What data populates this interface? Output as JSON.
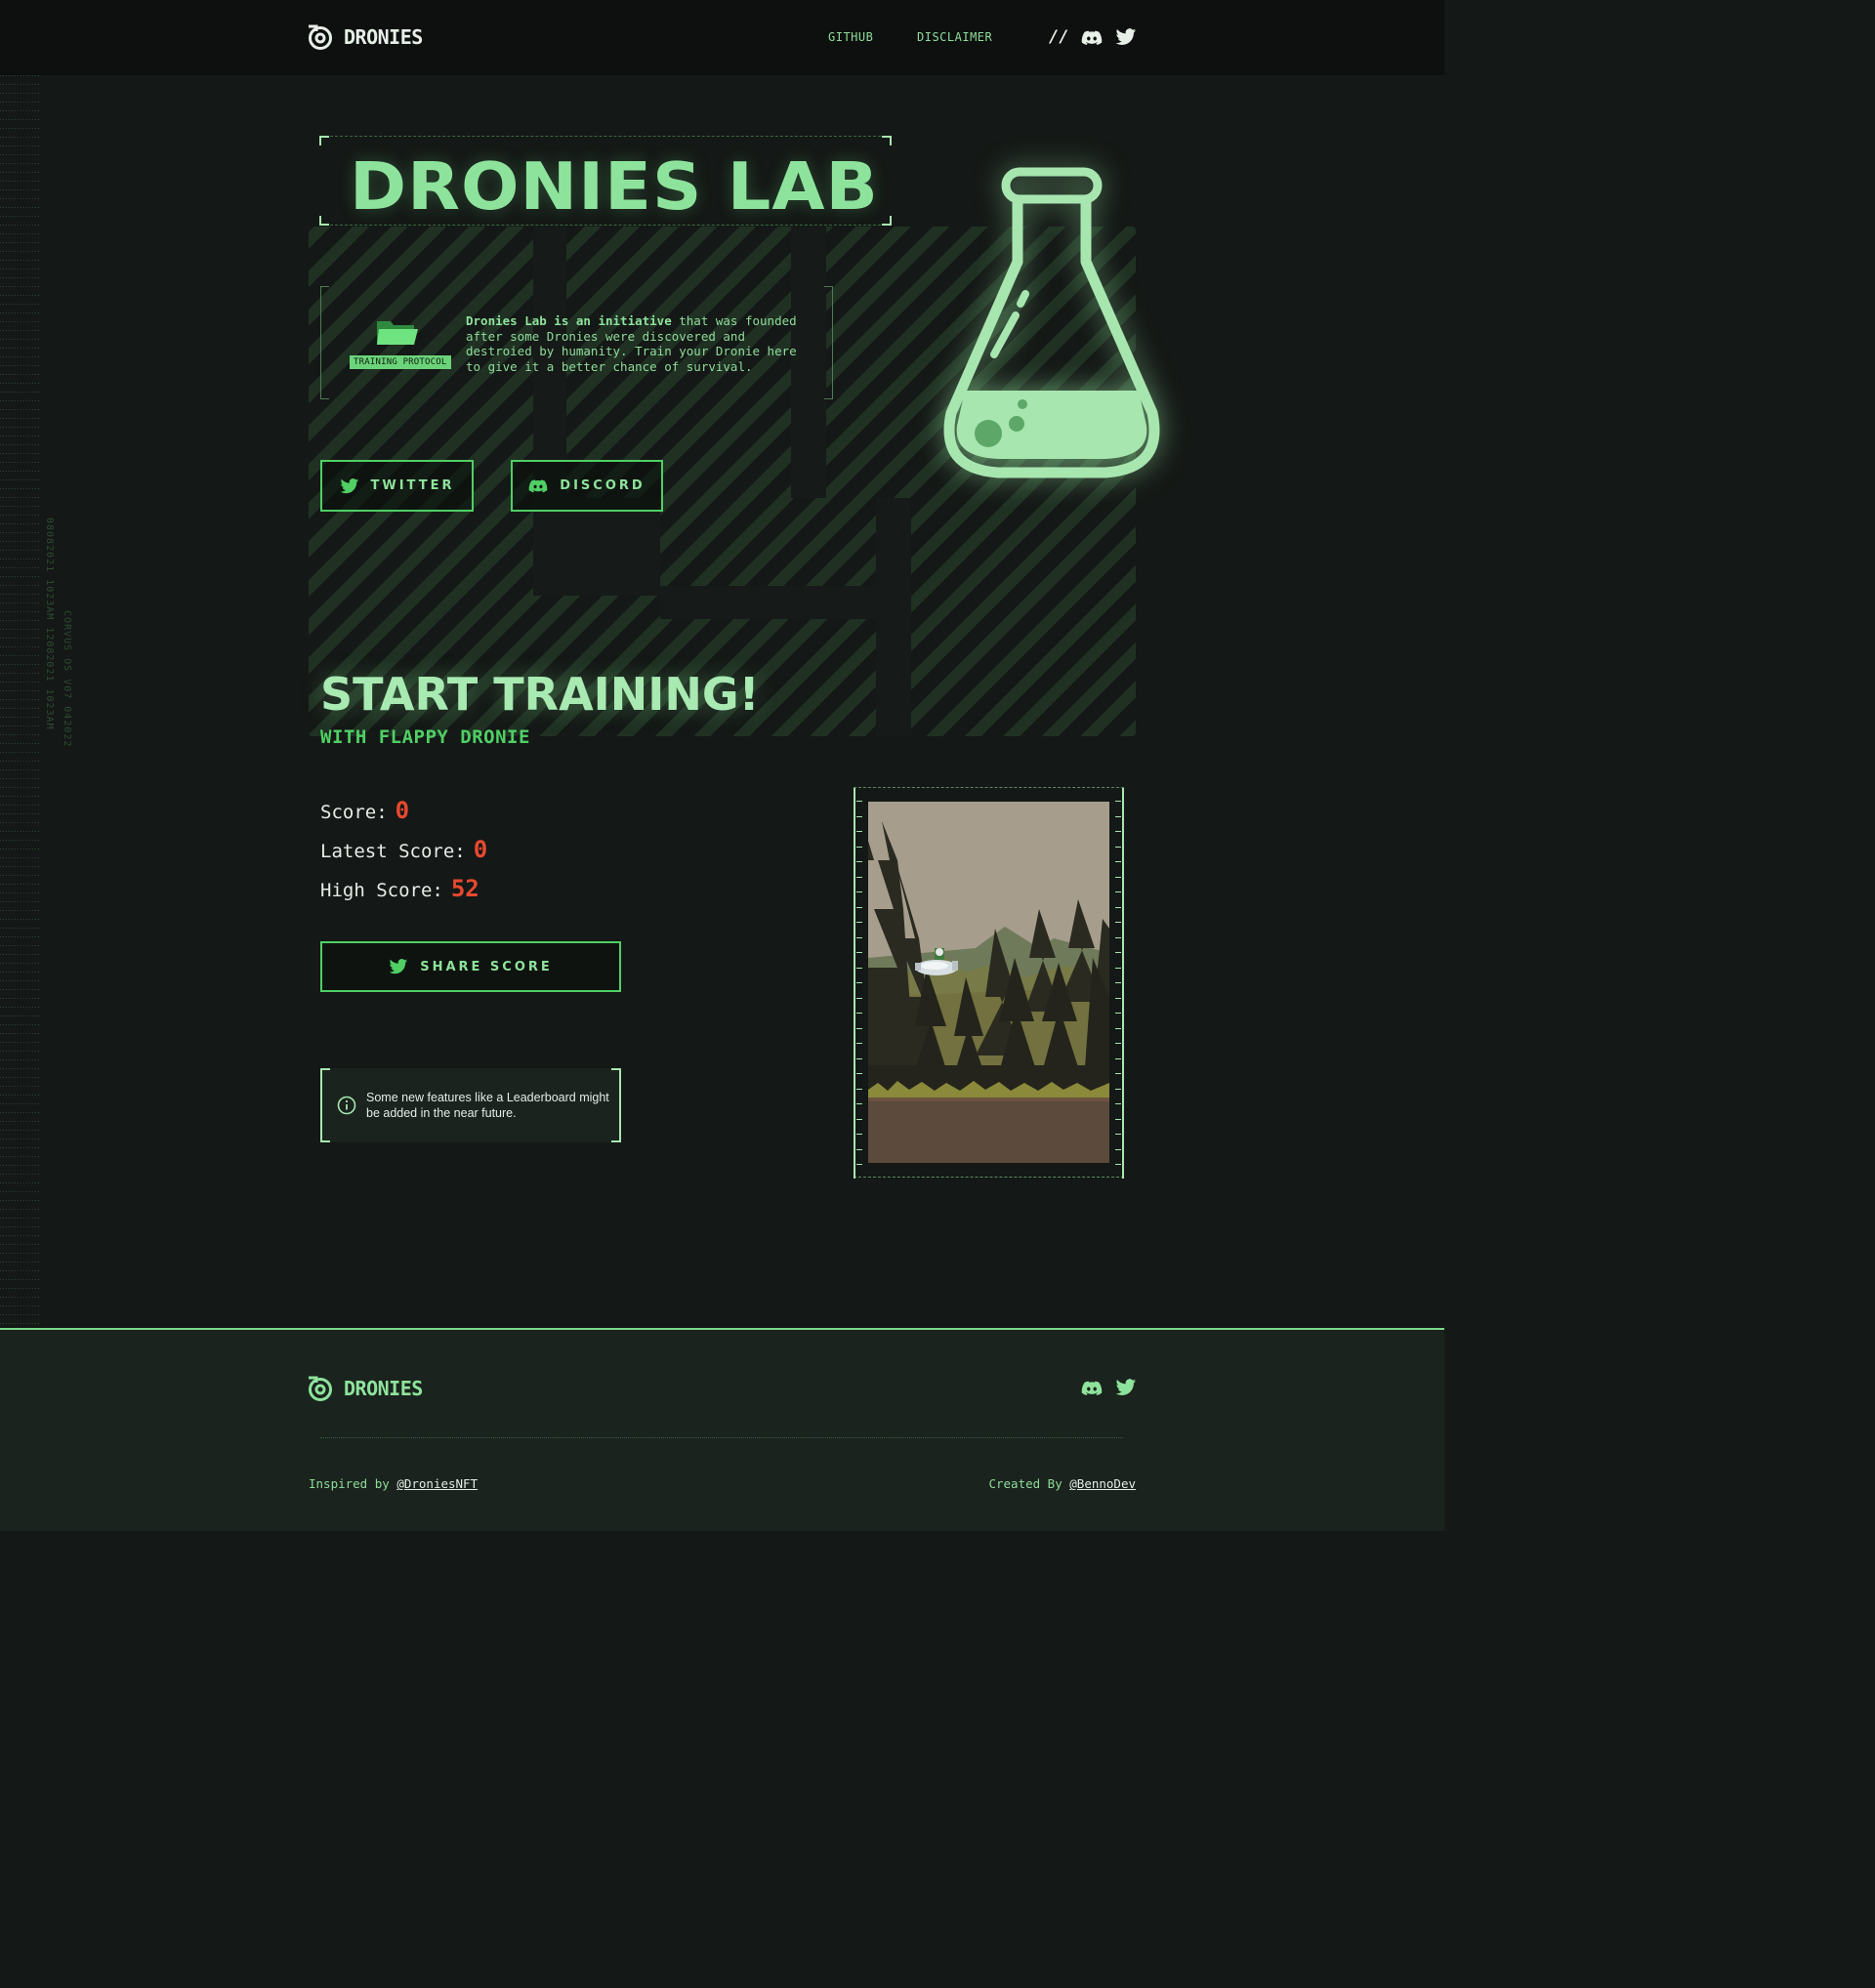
{
  "brand": {
    "name": "DRONIES"
  },
  "nav": {
    "links": [
      "GITHUB",
      "DISCLAIMER"
    ],
    "separator": "//"
  },
  "sidebar_text": {
    "line1": "08082021 1023AM 12082021 1023AM",
    "line2": "CORVUS OS V07 042022"
  },
  "hero": {
    "title": "DRONIES LAB",
    "badge": "TRAINING PROTOCOL",
    "intro_bold": "Dronies Lab is an initiative",
    "intro_rest": " that was founded after some Dronies were discovered and destroied by humanity. Train your Dronie here to give it a better chance of survival.",
    "buttons": {
      "twitter": "TWITTER",
      "discord": "DISCORD"
    }
  },
  "training": {
    "title": "START TRAINING!",
    "subtitle": "WITH FLAPPY DRONIE",
    "score_label": "Score:",
    "score": "0",
    "latest_label": "Latest Score:",
    "latest": "0",
    "high_label": "High Score:",
    "high": "52",
    "share": "SHARE SCORE",
    "notice": "Some new features like a Leaderboard might be added in the near future."
  },
  "footer": {
    "inspired_prefix": "Inspired by ",
    "inspired_link": "@DroniesNFT",
    "created_prefix": "Created By ",
    "created_link": "@BennoDev"
  },
  "colors": {
    "accent": "#8ee39c",
    "accent_strong": "#4fcf64",
    "score": "#e8492f",
    "bg": "#141816",
    "footer_bg": "#1a231d"
  },
  "icons": [
    "dronies-logo-icon",
    "discord-icon",
    "twitter-icon",
    "folder-icon",
    "flask-icon",
    "info-icon"
  ]
}
